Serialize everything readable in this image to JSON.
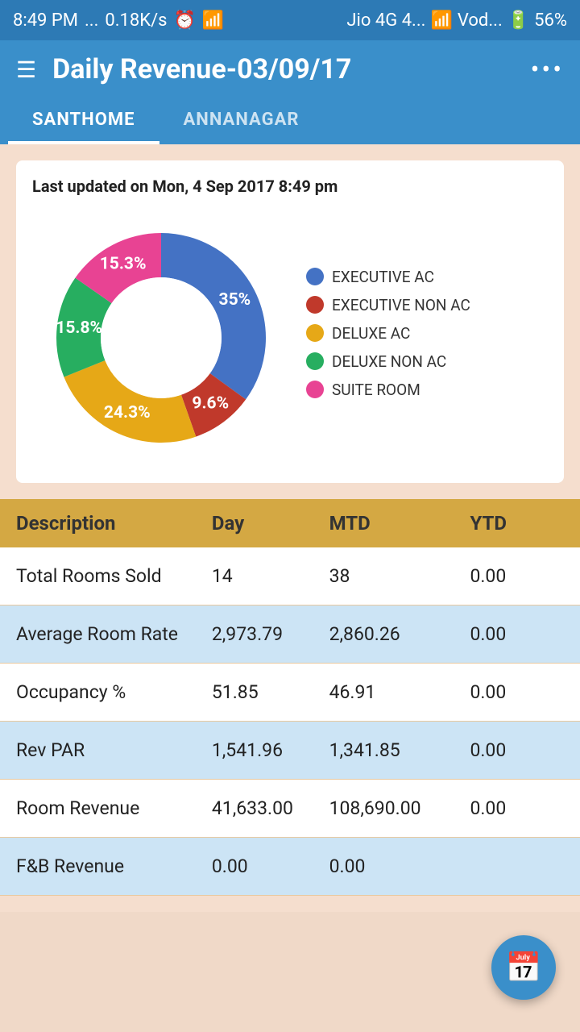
{
  "statusBar": {
    "time": "8:49 PM",
    "network1": "0.18K/s",
    "alarm": "⏰",
    "wifi": "WiFi",
    "signal1": "Jio 4G 4...",
    "signal2": "Vod...",
    "battery": "56%"
  },
  "header": {
    "title": "Daily Revenue-03/09/17",
    "dotsLabel": "•••"
  },
  "tabs": [
    {
      "label": "SANTHOME",
      "active": true
    },
    {
      "label": "ANNANAGAR",
      "active": false
    }
  ],
  "chart": {
    "updatedText": "Last updated on Mon, 4 Sep 2017 8:49 pm",
    "segments": [
      {
        "label": "EXECUTIVE AC",
        "percentage": 35,
        "color": "#4472c4",
        "textColor": "white",
        "startAngle": -90,
        "sweep": 126
      },
      {
        "label": "EXECUTIVE NON AC",
        "percentage": 9.6,
        "color": "#c0392b",
        "textColor": "white",
        "startAngle": 36,
        "sweep": 34.56
      },
      {
        "label": "DELUXE AC",
        "percentage": 24.3,
        "color": "#e6a817",
        "textColor": "white",
        "startAngle": 70.56,
        "sweep": 87.48
      },
      {
        "label": "DELUXE NON AC",
        "percentage": 15.8,
        "color": "#27ae60",
        "textColor": "white",
        "startAngle": 158.04,
        "sweep": 56.88
      },
      {
        "label": "SUITE ROOM",
        "percentage": 15.3,
        "color": "#e84393",
        "textColor": "white",
        "startAngle": 214.92,
        "sweep": 55.08
      }
    ],
    "legendColors": [
      "#4472c4",
      "#c0392b",
      "#e6a817",
      "#27ae60",
      "#e84393"
    ],
    "legendLabels": [
      "EXECUTIVE AC",
      "EXECUTIVE NON AC",
      "DELUXE AC",
      "DELUXE NON AC",
      "SUITE ROOM"
    ]
  },
  "table": {
    "headers": {
      "description": "Description",
      "day": "Day",
      "mtd": "MTD",
      "ytd": "YTD"
    },
    "rows": [
      {
        "description": "Total Rooms Sold",
        "day": "14",
        "mtd": "38",
        "ytd": "0.00",
        "alt": false
      },
      {
        "description": "Average Room Rate",
        "day": "2,973.79",
        "mtd": "2,860.26",
        "ytd": "0.00",
        "alt": true
      },
      {
        "description": "Occupancy %",
        "day": "51.85",
        "mtd": "46.91",
        "ytd": "0.00",
        "alt": false
      },
      {
        "description": "Rev PAR",
        "day": "1,541.96",
        "mtd": "1,341.85",
        "ytd": "0.00",
        "alt": true
      },
      {
        "description": "Room Revenue",
        "day": "41,633.00",
        "mtd": "108,690.00",
        "ytd": "0.00",
        "alt": false
      },
      {
        "description": "F&B Revenue",
        "day": "0.00",
        "mtd": "0.00",
        "ytd": "",
        "alt": true
      }
    ]
  },
  "fab": {
    "icon": "📅"
  }
}
